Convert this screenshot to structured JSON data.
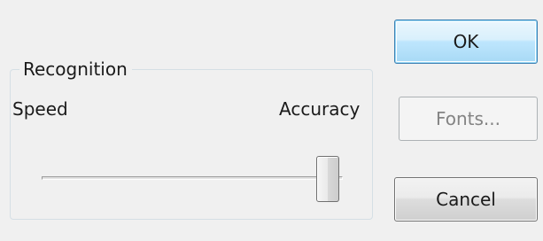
{
  "group": {
    "title": "Recognition",
    "min_label": "Speed",
    "max_label": "Accuracy"
  },
  "slider": {
    "value_fraction": 0.95
  },
  "buttons": {
    "ok_label": "OK",
    "fonts_label": "Fonts...",
    "fonts_enabled": false,
    "cancel_label": "Cancel"
  },
  "colors": {
    "dialog_background": "#f0f0f0",
    "default_button_border": "#3c7fb1",
    "disabled_text": "#838383"
  }
}
